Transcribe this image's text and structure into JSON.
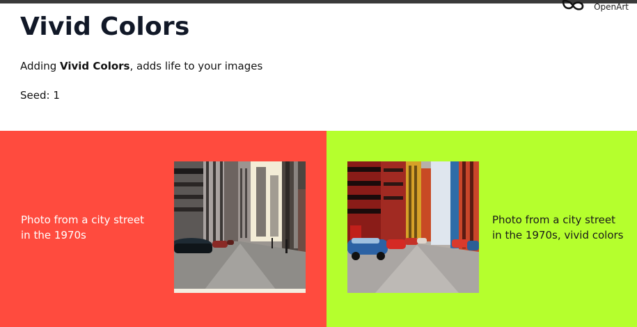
{
  "brand": {
    "name": "OpenArt",
    "icon": "openart-logo-icon"
  },
  "header": {
    "title": "Vivid Colors",
    "description_prefix": "Adding ",
    "description_bold": "Vivid Colors",
    "description_suffix": ", adds life to your images",
    "seed": "Seed: 1"
  },
  "comparison": {
    "left": {
      "background": "#ff4b3e",
      "caption_line1": "Photo from a city street",
      "caption_line2": "in the 1970s"
    },
    "right": {
      "background": "#b5ff2d",
      "caption_line1": "Photo from a city street",
      "caption_line2": "in the 1970s, vivid colors"
    }
  },
  "colors": {
    "top_bar": "#3a3a3a",
    "title": "#111827"
  }
}
